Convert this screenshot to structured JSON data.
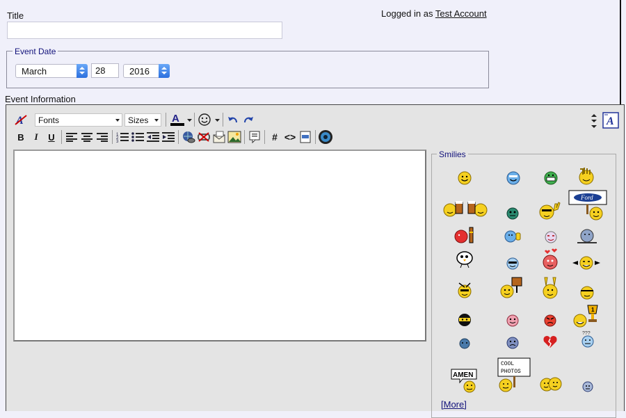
{
  "title_field": {
    "label": "Title",
    "value": ""
  },
  "login": {
    "prefix": "Logged in as",
    "account": "Test Account"
  },
  "event_date": {
    "legend": "Event Date",
    "month": "March",
    "day": "28",
    "year": "2016"
  },
  "event_info": {
    "label": "Event Information",
    "body": ""
  },
  "toolbar": {
    "font_select": "Fonts",
    "size_select": "Sizes",
    "buttons_row1": [
      "remove-format",
      "fonts",
      "sizes",
      "text-color",
      "emoticons",
      "undo",
      "redo"
    ],
    "buttons_row2": [
      "bold",
      "italic",
      "underline",
      "align-left",
      "align-center",
      "align-right",
      "ordered-list",
      "unordered-list",
      "outdent",
      "indent",
      "insert-link",
      "unlink",
      "email",
      "image",
      "quote",
      "hash",
      "code",
      "media",
      "preview"
    ],
    "bold_label": "B",
    "italic_label": "I",
    "underline_label": "U",
    "hash_label": "#",
    "code_label": "<>",
    "color_label": "A"
  },
  "smilies": {
    "legend": "Smilies",
    "more_label": "[More]",
    "items": [
      "smile",
      "cool-blue",
      "grin",
      "wave",
      "cheers",
      "alien",
      "rock-on",
      "ford-sign",
      "ball-pole",
      "thumbs-up",
      "dizzy",
      "sad-blob",
      "bird",
      "sunglasses",
      "love",
      "lol",
      "dance",
      "sign",
      "bunny",
      "stretch",
      "ninja",
      "pink",
      "angry",
      "trophy",
      "blue",
      "worried",
      "broken-heart",
      "confused",
      "amen",
      "cool-photos",
      "hug",
      "tiny"
    ],
    "amen_text": "AMEN",
    "cool_photos_text": "COOL PHOTOS"
  },
  "colors": {
    "accent_blue": "#2b6fde",
    "legend_navy": "#11117a",
    "smiley_yellow": "#f5d020"
  }
}
